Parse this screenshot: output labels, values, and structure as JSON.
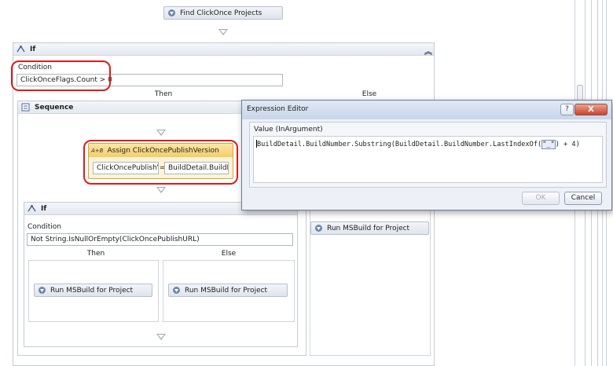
{
  "top_activity": {
    "label": "Find ClickOnce Projects"
  },
  "outer_if": {
    "header": "If",
    "condition_label": "Condition",
    "condition_value": "ClickOnceFlags.Count > 0",
    "then_label": "Then",
    "else_label": "Else"
  },
  "sequence": {
    "header": "Sequence",
    "assign": {
      "title": "Assign ClickOncePublishVersion",
      "icon_text": "A+B",
      "to_value": "ClickOncePublishV",
      "equals": "=",
      "value_value": "BuildDetail.BuildNu"
    }
  },
  "inner_if": {
    "header": "If",
    "condition_label": "Condition",
    "condition_value": "Not String.IsNullOrEmpty(ClickOncePublishURL)",
    "then_label": "Then",
    "else_label": "Else",
    "then_activity": "Run MSBuild for Project",
    "else_activity": "Run MSBuild for Project"
  },
  "else_activity": "Run MSBuild for Project",
  "dialog": {
    "title": "Expression Editor",
    "help": "?",
    "close": "X",
    "value_label": "Value (InArgument)",
    "expression_pre": "BuildDetail.BuildNumber.Substring(BuildDetail.BuildNumber.LastIndexOf(",
    "expression_hl": "\"_\"",
    "expression_post": ") + 4)",
    "ok_label": "OK",
    "cancel_label": "Cancel"
  },
  "colors": {
    "highlight_outline": "#e11a1a",
    "activity_fill": "#e3e8f0",
    "assign_fill": "#f9d77e"
  }
}
